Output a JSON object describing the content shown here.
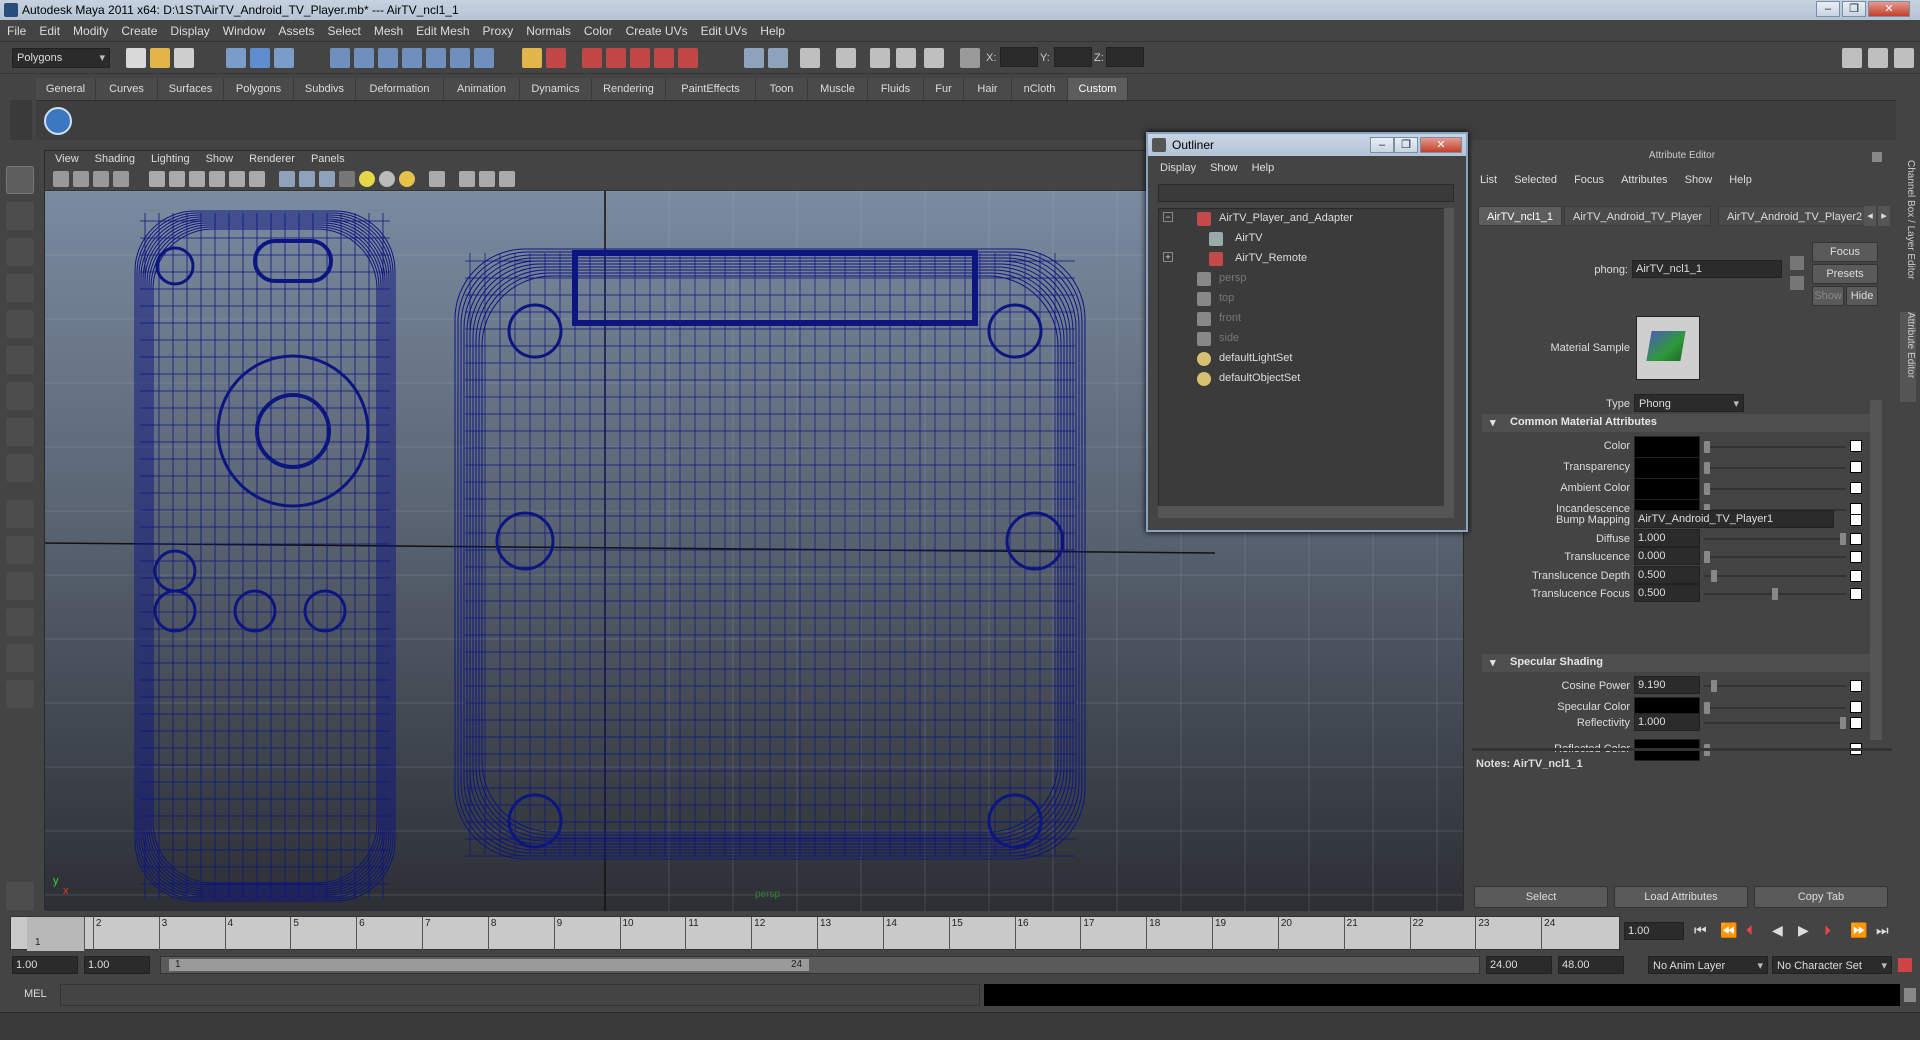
{
  "window": {
    "title": "Autodesk Maya 2011 x64: D:\\1ST\\AirTV_Android_TV_Player.mb*   ---   AirTV_ncl1_1",
    "controls": [
      "–",
      "❐",
      "✕"
    ]
  },
  "menubar": [
    "File",
    "Edit",
    "Modify",
    "Create",
    "Display",
    "Window",
    "Assets",
    "Select",
    "Mesh",
    "Edit Mesh",
    "Proxy",
    "Normals",
    "Color",
    "Create UVs",
    "Edit UVs",
    "Help"
  ],
  "statusline": {
    "menuset": "Polygons",
    "coord_labels": [
      "X:",
      "Y:",
      "Z:"
    ]
  },
  "shelf": {
    "tabs": [
      "General",
      "Curves",
      "Surfaces",
      "Polygons",
      "Subdivs",
      "Deformation",
      "Animation",
      "Dynamics",
      "Rendering",
      "PaintEffects",
      "Toon",
      "Muscle",
      "Fluids",
      "Fur",
      "Hair",
      "nCloth",
      "Custom"
    ],
    "active": "Custom"
  },
  "viewport": {
    "menu": [
      "View",
      "Shading",
      "Lighting",
      "Show",
      "Renderer",
      "Panels"
    ],
    "camera_label": "persp",
    "axis_x": "x",
    "axis_y": "y",
    "wire_color": "#0d1580"
  },
  "outliner": {
    "title": "Outliner",
    "menu": [
      "Display",
      "Show",
      "Help"
    ],
    "items": [
      {
        "label": "AirTV_Player_and_Adapter",
        "indent": 0,
        "expander": "−",
        "icon": "transform-icon",
        "dim": false
      },
      {
        "label": "AirTV",
        "indent": 1,
        "expander": "",
        "icon": "mesh-icon",
        "dim": false
      },
      {
        "label": "AirTV_Remote",
        "indent": 1,
        "expander": "+",
        "icon": "transform-icon",
        "dim": false
      },
      {
        "label": "persp",
        "indent": 0,
        "expander": "",
        "icon": "camera-icon",
        "dim": true
      },
      {
        "label": "top",
        "indent": 0,
        "expander": "",
        "icon": "camera-icon",
        "dim": true
      },
      {
        "label": "front",
        "indent": 0,
        "expander": "",
        "icon": "camera-icon",
        "dim": true
      },
      {
        "label": "side",
        "indent": 0,
        "expander": "",
        "icon": "camera-icon",
        "dim": true
      },
      {
        "label": "defaultLightSet",
        "indent": 0,
        "expander": "",
        "icon": "set-icon",
        "dim": false
      },
      {
        "label": "defaultObjectSet",
        "indent": 0,
        "expander": "",
        "icon": "set-icon",
        "dim": false
      }
    ]
  },
  "attribute_editor": {
    "title": "Attribute Editor",
    "menu": [
      "List",
      "Selected",
      "Focus",
      "Attributes",
      "Show",
      "Help"
    ],
    "tabs": [
      "AirTV_ncl1_1",
      "AirTV_Android_TV_Player",
      "AirTV_Android_TV_Player2"
    ],
    "node_type_label": "phong:",
    "node_name": "AirTV_ncl1_1",
    "buttons_right": [
      "Focus",
      "Presets",
      "Show",
      "Hide"
    ],
    "material_sample_label": "Material Sample",
    "type_label": "Type",
    "type_value": "Phong",
    "sections": {
      "common": "Common Material Attributes",
      "specular": "Specular Shading"
    },
    "common_attrs": [
      {
        "label": "Color",
        "kind": "swatch"
      },
      {
        "label": "Transparency",
        "kind": "swatch"
      },
      {
        "label": "Ambient Color",
        "kind": "swatch"
      },
      {
        "label": "Incandescence",
        "kind": "swatch"
      },
      {
        "label": "Bump Mapping",
        "kind": "text",
        "value": "AirTV_Android_TV_Player1"
      },
      {
        "label": "Diffuse",
        "kind": "number",
        "value": "1.000",
        "level": 1.0
      },
      {
        "label": "Translucence",
        "kind": "number",
        "value": "0.000",
        "level": 0.0
      },
      {
        "label": "Translucence Depth",
        "kind": "number",
        "value": "0.500",
        "level": 0.05
      },
      {
        "label": "Translucence Focus",
        "kind": "number",
        "value": "0.500",
        "level": 0.5
      }
    ],
    "specular_attrs": [
      {
        "label": "Cosine Power",
        "kind": "number",
        "value": "9.190",
        "level": 0.05
      },
      {
        "label": "Specular Color",
        "kind": "swatch"
      },
      {
        "label": "Reflectivity",
        "kind": "number",
        "value": "1.000",
        "level": 1.0
      },
      {
        "label": "Reflected Color",
        "kind": "swatch"
      }
    ],
    "notes_label": "Notes:  AirTV_ncl1_1",
    "bottom_buttons": [
      "Select",
      "Load Attributes",
      "Copy Tab"
    ]
  },
  "side_tabs": [
    "Channel Box / Layer Editor",
    "Attribute Editor"
  ],
  "timeline": {
    "ticks": [
      "1",
      "2",
      "3",
      "4",
      "5",
      "6",
      "7",
      "8",
      "9",
      "10",
      "11",
      "12",
      "13",
      "14",
      "15",
      "16",
      "17",
      "18",
      "19",
      "20",
      "21",
      "22",
      "23",
      "24"
    ],
    "current_frame_label": "1",
    "current_time": "1.00"
  },
  "range": {
    "start": "1.00",
    "start2": "1.00",
    "range_start_label": "1",
    "range_end_label": "24",
    "end": "24.00",
    "end2": "48.00",
    "anim_layer": "No Anim Layer",
    "character_set": "No Character Set"
  },
  "command_line": {
    "label": "MEL"
  }
}
